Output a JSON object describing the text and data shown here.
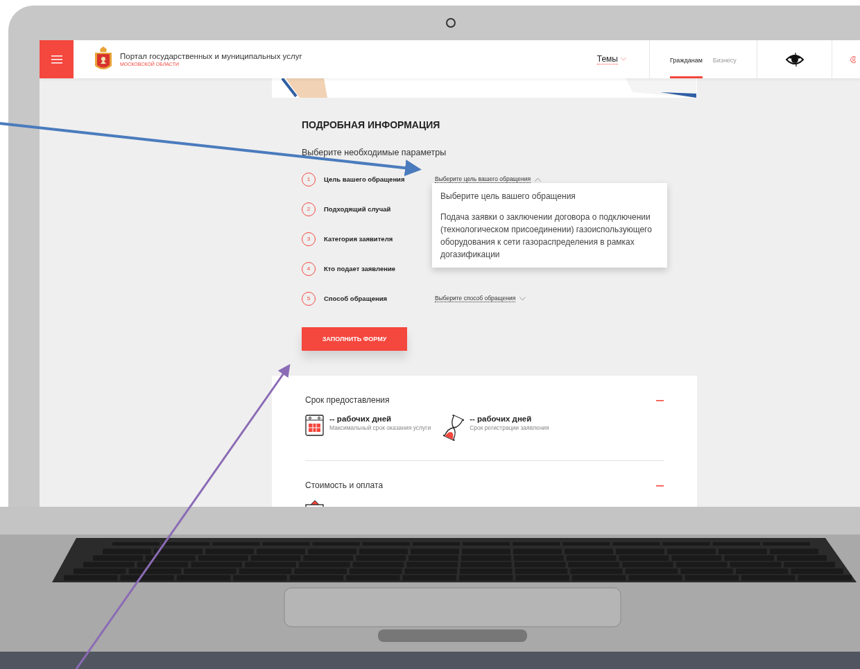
{
  "header": {
    "brand_title": "Портал государственных и муниципальных услуг",
    "brand_subtitle": "МОСКОВСКОЙ ОБЛАСТИ",
    "themes_menu": "Темы",
    "audience_tabs": [
      {
        "label": "Гражданам",
        "selected": true
      },
      {
        "label": "Бизнесу",
        "selected": false
      }
    ]
  },
  "details": {
    "title": "ПОДРОБНАЯ ИНФОРМАЦИЯ",
    "subtitle": "Выберите необходимые параметры",
    "params": [
      {
        "number": "1",
        "label": "Цель вашего обращения",
        "value": "Выберите цель вашего обращения",
        "expanded": true,
        "options": [
          "Выберите цель вашего обращения",
          "Подача заявки о заключении договора о подключении (технологическом присоединении) газоиспользующего оборудования к сети газораспределения в рамках догазификации"
        ]
      },
      {
        "number": "2",
        "label": "Подходящий случай"
      },
      {
        "number": "3",
        "label": "Категория заявителя"
      },
      {
        "number": "4",
        "label": "Кто подает заявление"
      },
      {
        "number": "5",
        "label": "Способ обращения",
        "value": "Выберите способ обращения",
        "expanded": false
      }
    ],
    "submit_button": "ЗАПОЛНИТЬ ФОРМУ"
  },
  "info_sections": [
    {
      "title": "Срок предоставления",
      "expanded": true,
      "items": [
        {
          "kind": "calendar",
          "value": "-- рабочих дней",
          "caption": "Максимальный срок оказания услуги"
        },
        {
          "kind": "hourglass",
          "value": "-- рабочих дней",
          "caption": "Срок регистрации заявления"
        }
      ]
    },
    {
      "title": "Стоимость и оплата",
      "expanded": true,
      "items": [
        {
          "kind": "wallet"
        }
      ]
    }
  ]
}
